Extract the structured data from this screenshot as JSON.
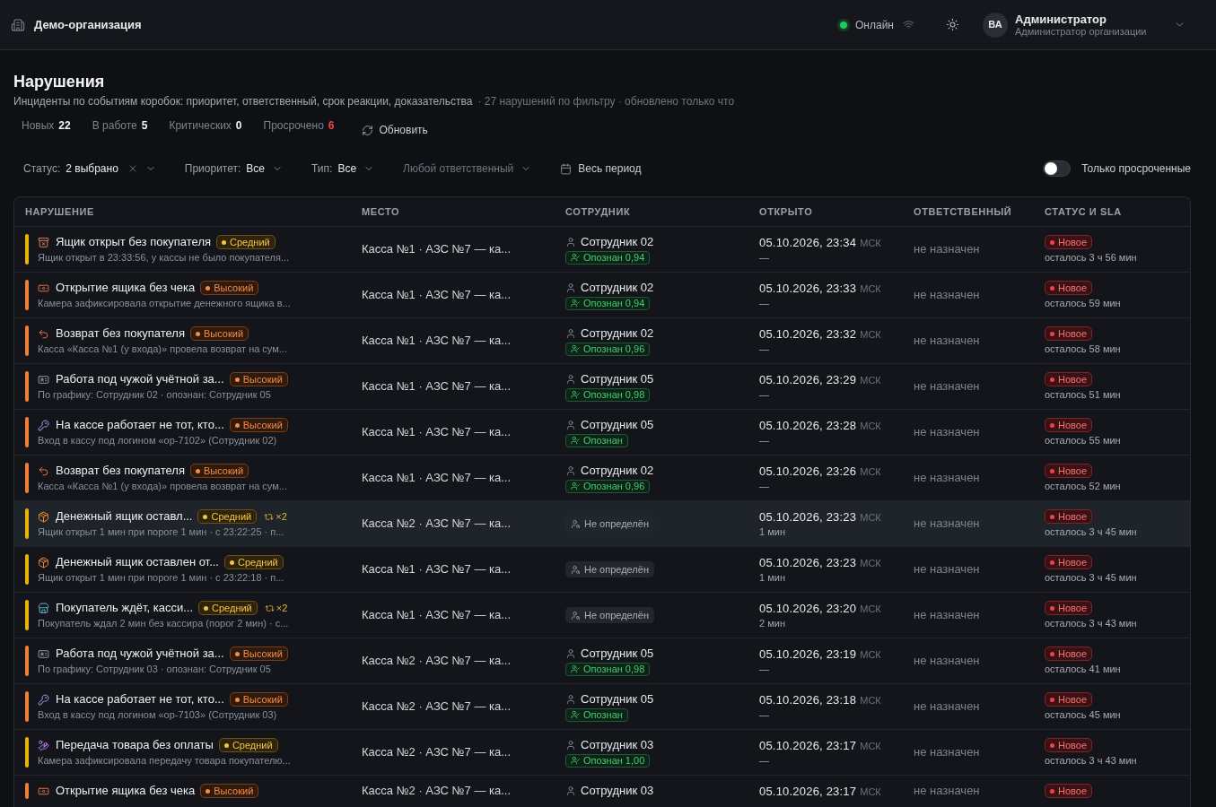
{
  "header": {
    "organization": "Демо-организация",
    "connection": {
      "label": "Онлайн",
      "online": true
    },
    "user": {
      "initials": "ВА",
      "name": "Администратор",
      "role": "Администратор организации"
    }
  },
  "page": {
    "title": "Нарушения",
    "description": "Инциденты по событиям коробок: приоритет, ответственный, срок реакции, доказательства",
    "meta": "· 27 нарушений по фильтру · обновлено только что"
  },
  "stats": [
    {
      "label": "Новых",
      "value": "22",
      "alert": false
    },
    {
      "label": "В работе",
      "value": "5",
      "alert": false
    },
    {
      "label": "Критических",
      "value": "0",
      "alert": false
    },
    {
      "label": "Просрочено",
      "value": "6",
      "alert": true
    }
  ],
  "refresh_button": "Обновить",
  "filters": [
    {
      "kind": "select",
      "label": "Статус:",
      "value": "2 выбрано",
      "clearable": true
    },
    {
      "kind": "select",
      "label": "Приоритет:",
      "value": "Все",
      "clearable": false
    },
    {
      "kind": "select",
      "label": "Тип:",
      "value": "Все",
      "clearable": false
    },
    {
      "kind": "select",
      "placeholder": "Любой ответственный",
      "clearable": false
    },
    {
      "kind": "date",
      "value": "Весь период"
    }
  ],
  "overdue_toggle": {
    "label": "Только просроченные",
    "on": false
  },
  "table": {
    "columns": [
      "НАРУШЕНИЕ",
      "МЕСТО",
      "СОТРУДНИК",
      "ОТКРЫТО",
      "ОТВЕТСТВЕННЫЙ",
      "СТАТУС И SLA"
    ],
    "rows": [
      {
        "kind": "drawer",
        "title": "Ящик открыт без покупателя",
        "priority": {
          "label": "Средний",
          "kind": "medium"
        },
        "details": "Ящик открыт в 23:33:56, у кассы не было покупателя...",
        "location": "Касса №1 · АЗС №7 — ка...",
        "employee": {
          "kind": "identified",
          "name": "Сотрудник 02",
          "recognition": "Опознан 0,94"
        },
        "opened": {
          "date": "05.10.2026, 23:34",
          "timezone": "МСК",
          "duration": "—"
        },
        "assignee": "не назначен",
        "status": {
          "label": "Новое",
          "kind": "new"
        },
        "sla": "осталось 3 ч 56 мин",
        "highlighted": false
      },
      {
        "kind": "banknote",
        "title": "Открытие ящика без чека",
        "priority": {
          "label": "Высокий",
          "kind": "high"
        },
        "details": "Камера зафиксировала открытие денежного ящика в...",
        "location": "Касса №1 · АЗС №7 — ка...",
        "employee": {
          "kind": "identified",
          "name": "Сотрудник 02",
          "recognition": "Опознан 0,94"
        },
        "opened": {
          "date": "05.10.2026, 23:33",
          "timezone": "МСК",
          "duration": "—"
        },
        "assignee": "не назначен",
        "status": {
          "label": "Новое",
          "kind": "new"
        },
        "sla": "осталось 59 мин",
        "highlighted": false
      },
      {
        "kind": "refund",
        "title": "Возврат без покупателя",
        "priority": {
          "label": "Высокий",
          "kind": "high"
        },
        "details": "Касса «Касса №1 (у входа)» провела возврат на сум...",
        "location": "Касса №1 · АЗС №7 — ка...",
        "employee": {
          "kind": "identified",
          "name": "Сотрудник 02",
          "recognition": "Опознан 0,96"
        },
        "opened": {
          "date": "05.10.2026, 23:32",
          "timezone": "МСК",
          "duration": "—"
        },
        "assignee": "не назначен",
        "status": {
          "label": "Новое",
          "kind": "new"
        },
        "sla": "осталось 58 мин",
        "highlighted": false
      },
      {
        "kind": "id",
        "title": "Работа под чужой учётной за...",
        "priority": {
          "label": "Высокий",
          "kind": "high"
        },
        "details": "По графику: Сотрудник 02 · опознан: Сотрудник 05",
        "location": "Касса №1 · АЗС №7 — ка...",
        "employee": {
          "kind": "identified",
          "name": "Сотрудник 05",
          "recognition": "Опознан 0,98"
        },
        "opened": {
          "date": "05.10.2026, 23:29",
          "timezone": "МСК",
          "duration": "—"
        },
        "assignee": "не назначен",
        "status": {
          "label": "Новое",
          "kind": "new"
        },
        "sla": "осталось 51 мин",
        "highlighted": false
      },
      {
        "kind": "key",
        "title": "На кассе работает не тот, кто...",
        "priority": {
          "label": "Высокий",
          "kind": "high"
        },
        "details": "Вход в кассу под логином «op-7102» (Сотрудник 02)",
        "location": "Касса №1 · АЗС №7 — ка...",
        "employee": {
          "kind": "identified",
          "name": "Сотрудник 05",
          "recognition": "Опознан"
        },
        "opened": {
          "date": "05.10.2026, 23:28",
          "timezone": "МСК",
          "duration": "—"
        },
        "assignee": "не назначен",
        "status": {
          "label": "Новое",
          "kind": "new"
        },
        "sla": "осталось 55 мин",
        "highlighted": false
      },
      {
        "kind": "refund",
        "title": "Возврат без покупателя",
        "priority": {
          "label": "Высокий",
          "kind": "high"
        },
        "details": "Касса «Касса №1 (у входа)» провела возврат на сум...",
        "location": "Касса №1 · АЗС №7 — ка...",
        "employee": {
          "kind": "identified",
          "name": "Сотрудник 02",
          "recognition": "Опознан 0,96"
        },
        "opened": {
          "date": "05.10.2026, 23:26",
          "timezone": "МСК",
          "duration": "—"
        },
        "assignee": "не назначен",
        "status": {
          "label": "Новое",
          "kind": "new"
        },
        "sla": "осталось 52 мин",
        "highlighted": false
      },
      {
        "kind": "package",
        "title": "Денежный ящик оставл...",
        "priority": {
          "label": "Средний",
          "kind": "medium"
        },
        "repeat": "×2",
        "details": "Ящик открыт 1 мин при пороге 1 мин · с 23:22:25 · п...",
        "location": "Касса №2 · АЗС №7 — ка...",
        "employee": {
          "kind": "unknown",
          "label": "Не определён"
        },
        "opened": {
          "date": "05.10.2026, 23:23",
          "timezone": "МСК",
          "duration": "1 мин"
        },
        "assignee": "не назначен",
        "status": {
          "label": "Новое",
          "kind": "new"
        },
        "sla": "осталось 3 ч 45 мин",
        "highlighted": true
      },
      {
        "kind": "package",
        "title": "Денежный ящик оставлен от...",
        "priority": {
          "label": "Средний",
          "kind": "medium"
        },
        "details": "Ящик открыт 1 мин при пороге 1 мин · с 23:22:18 · п...",
        "location": "Касса №1 · АЗС №7 — ка...",
        "employee": {
          "kind": "unknown",
          "label": "Не определён"
        },
        "opened": {
          "date": "05.10.2026, 23:23",
          "timezone": "МСК",
          "duration": "1 мин"
        },
        "assignee": "не назначен",
        "status": {
          "label": "Новое",
          "kind": "new"
        },
        "sla": "осталось 3 ч 45 мин",
        "highlighted": false
      },
      {
        "kind": "store",
        "title": "Покупатель ждёт, касси...",
        "priority": {
          "label": "Средний",
          "kind": "medium"
        },
        "repeat": "×2",
        "details": "Покупатель ждал 2 мин без кассира (порог 2 мин) · с...",
        "location": "Касса №1 · АЗС №7 — ка...",
        "employee": {
          "kind": "unknown",
          "label": "Не определён"
        },
        "opened": {
          "date": "05.10.2026, 23:20",
          "timezone": "МСК",
          "duration": "2 мин"
        },
        "assignee": "не назначен",
        "status": {
          "label": "Новое",
          "kind": "new"
        },
        "sla": "осталось 3 ч 43 мин",
        "highlighted": false
      },
      {
        "kind": "id",
        "title": "Работа под чужой учётной за...",
        "priority": {
          "label": "Высокий",
          "kind": "high"
        },
        "details": "По графику: Сотрудник 03 · опознан: Сотрудник 05",
        "location": "Касса №2 · АЗС №7 — ка...",
        "employee": {
          "kind": "identified",
          "name": "Сотрудник 05",
          "recognition": "Опознан 0,98"
        },
        "opened": {
          "date": "05.10.2026, 23:19",
          "timezone": "МСК",
          "duration": "—"
        },
        "assignee": "не назначен",
        "status": {
          "label": "Новое",
          "kind": "new"
        },
        "sla": "осталось 41 мин",
        "highlighted": false
      },
      {
        "kind": "key",
        "title": "На кассе работает не тот, кто...",
        "priority": {
          "label": "Высокий",
          "kind": "high"
        },
        "details": "Вход в кассу под логином «op-7103» (Сотрудник 03)",
        "location": "Касса №2 · АЗС №7 — ка...",
        "employee": {
          "kind": "identified",
          "name": "Сотрудник 05",
          "recognition": "Опознан"
        },
        "opened": {
          "date": "05.10.2026, 23:18",
          "timezone": "МСК",
          "duration": "—"
        },
        "assignee": "не назначен",
        "status": {
          "label": "Новое",
          "kind": "new"
        },
        "sla": "осталось 45 мин",
        "highlighted": false
      },
      {
        "kind": "handover",
        "title": "Передача товара без оплаты",
        "priority": {
          "label": "Средний",
          "kind": "medium"
        },
        "details": "Камера зафиксировала передачу товара покупателю...",
        "location": "Касса №2 · АЗС №7 — ка...",
        "employee": {
          "kind": "identified",
          "name": "Сотрудник 03",
          "recognition": "Опознан 1,00"
        },
        "opened": {
          "date": "05.10.2026, 23:17",
          "timezone": "МСК",
          "duration": "—"
        },
        "assignee": "не назначен",
        "status": {
          "label": "Новое",
          "kind": "new"
        },
        "sla": "осталось 3 ч 43 мин",
        "highlighted": false
      },
      {
        "kind": "banknote",
        "title": "Открытие ящика без чека",
        "priority": {
          "label": "Высокий",
          "kind": "high"
        },
        "location": "Касса №2 · АЗС №7 — ка...",
        "employee": {
          "kind": "identified",
          "name": "Сотрудник 03"
        },
        "opened": {
          "date": "05.10.2026, 23:17",
          "timezone": "МСК"
        },
        "assignee": "не назначен",
        "status": {
          "label": "Новое",
          "kind": "new"
        },
        "highlighted": false
      }
    ]
  }
}
